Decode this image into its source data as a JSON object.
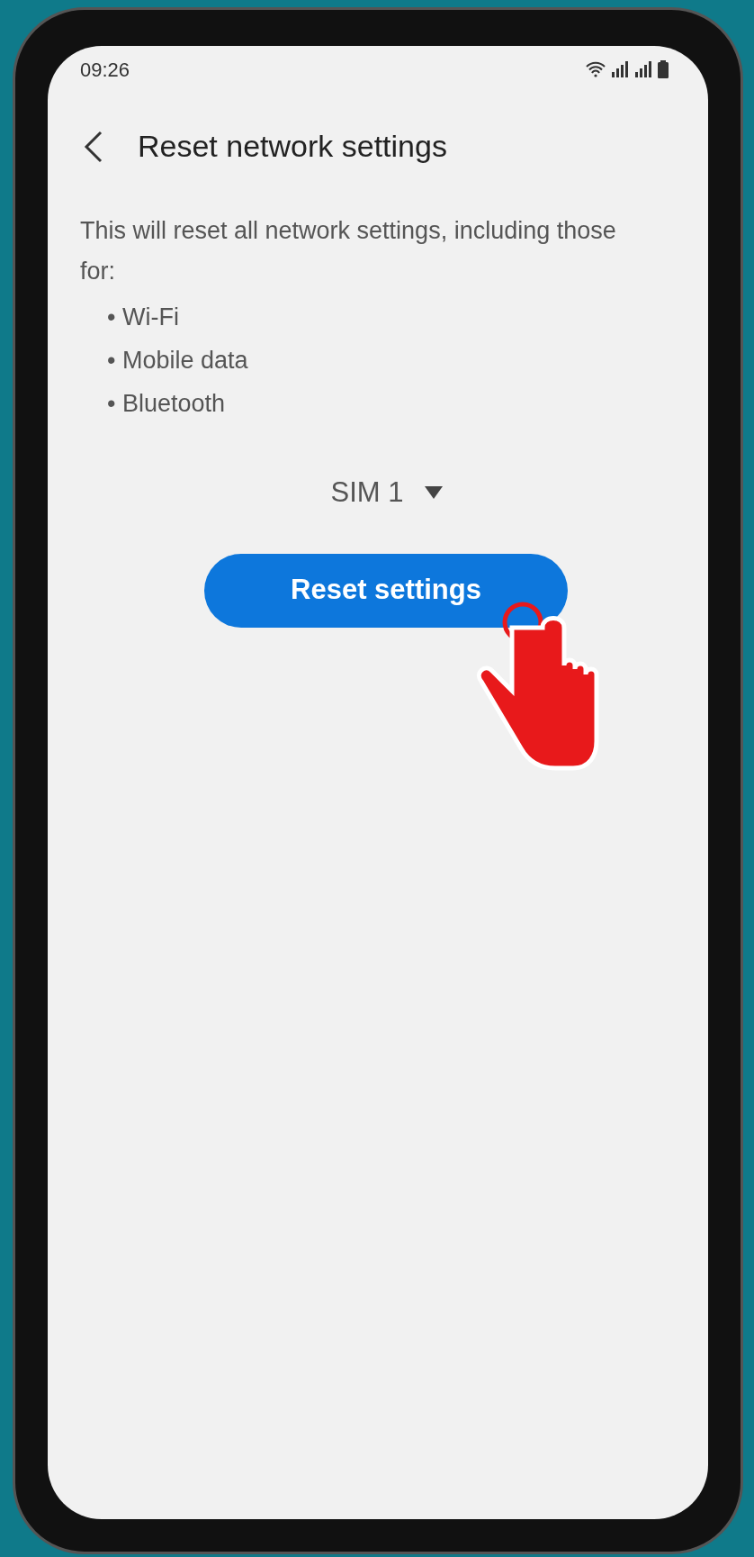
{
  "status_bar": {
    "time": "09:26"
  },
  "header": {
    "title": "Reset network settings"
  },
  "description": "This will reset all network settings, including those for:",
  "items": [
    "• Wi-Fi",
    "• Mobile data",
    "• Bluetooth"
  ],
  "sim_selector": {
    "label": "SIM 1"
  },
  "button": {
    "label": "Reset settings"
  }
}
